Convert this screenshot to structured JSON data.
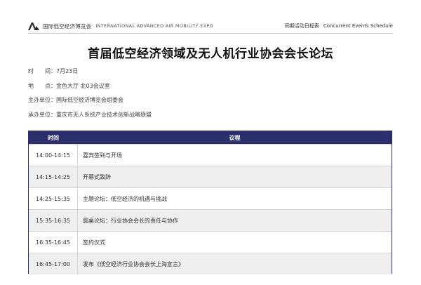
{
  "header": {
    "brand_cn": "国际低空经济博览会",
    "brand_en": "INTERNATIONAL ADVANCED AIR MOBILITY EXPO",
    "right_cn": "同期活动日程表",
    "right_en": "Concurrent Events Schedule",
    "logo_icon": "mountain-logo-icon"
  },
  "title": "首届低空经济领域及无人机行业协会会长论坛",
  "info": [
    {
      "label": "时　　间：",
      "value": "7月23日"
    },
    {
      "label": "地　　点：",
      "value": "金色大厅 北03会议室"
    },
    {
      "label": "主办单位：",
      "value": "国际低空经济博览会组委会"
    },
    {
      "label": "承办单位：",
      "value": "重庆市无人系统产业技术创新战略联盟"
    }
  ],
  "table": {
    "headers": {
      "time": "时间",
      "agenda": "议程"
    },
    "rows": [
      {
        "time": "14:00-14:15",
        "agenda": "嘉宾签到与开场"
      },
      {
        "time": "14:15-14:25",
        "agenda": "开幕式致辞"
      },
      {
        "time": "14:25-15:35",
        "agenda": "主题论坛：低空经济的机遇与挑战"
      },
      {
        "time": "15:35-16:35",
        "agenda": "圆桌论坛：行业协会会长的责任与协作"
      },
      {
        "time": "16:35-16:45",
        "agenda": "签约仪式"
      },
      {
        "time": "16:45-17:00",
        "agenda": "发布《低空经济行业协会会长上海宣言》"
      }
    ]
  },
  "colors": {
    "table_header": "#2b2f6b",
    "row_alt": "#efefef"
  }
}
